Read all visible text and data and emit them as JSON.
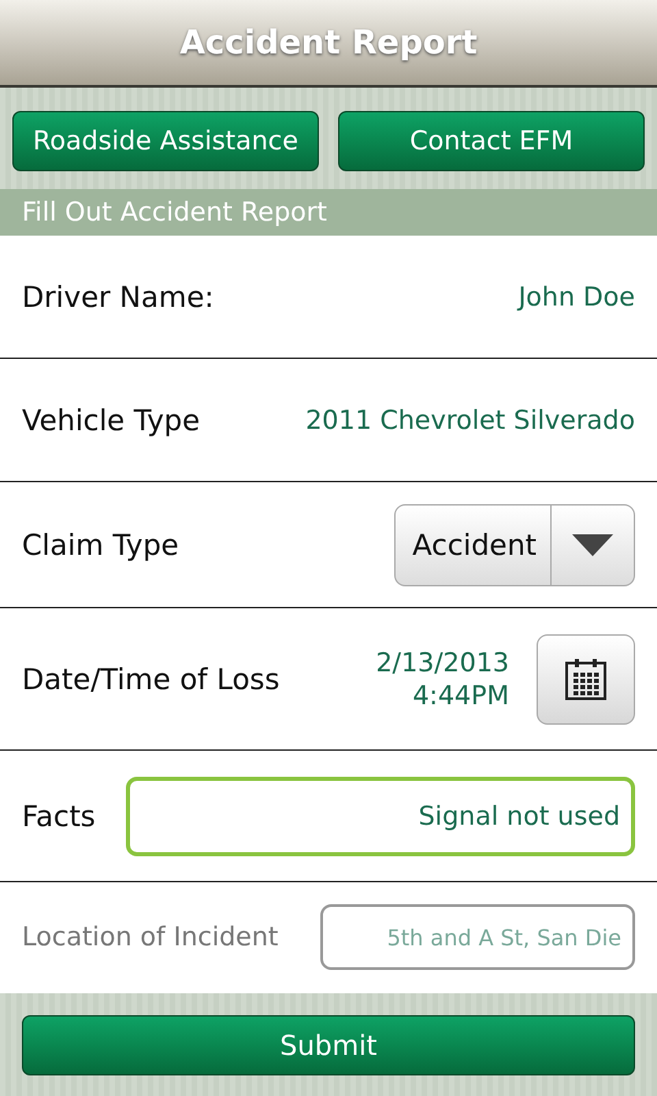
{
  "window": {
    "title": "Accident Report"
  },
  "actions": [
    {
      "label": "Roadside Assistance"
    },
    {
      "label": "Contact EFM"
    }
  ],
  "section": {
    "title": "Fill Out Accident Report"
  },
  "rows": [
    {
      "kind": "text",
      "label": "Driver Name:",
      "value": "John Doe"
    },
    {
      "kind": "text",
      "label": "Vehicle Type",
      "value": "2011 Chevrolet Silverado"
    },
    {
      "kind": "select",
      "label": "Claim Type",
      "value": "Accident"
    },
    {
      "kind": "date",
      "label": "Date/Time of Loss",
      "date": "2/13/2013",
      "time": "4:44PM"
    },
    {
      "kind": "input",
      "label": "Facts",
      "value": "Signal not used",
      "focused": true
    },
    {
      "kind": "input",
      "label": "Location of Incident",
      "value": "5th and A St, San Die",
      "focused": false
    }
  ],
  "submit": {
    "label": "Submit"
  }
}
